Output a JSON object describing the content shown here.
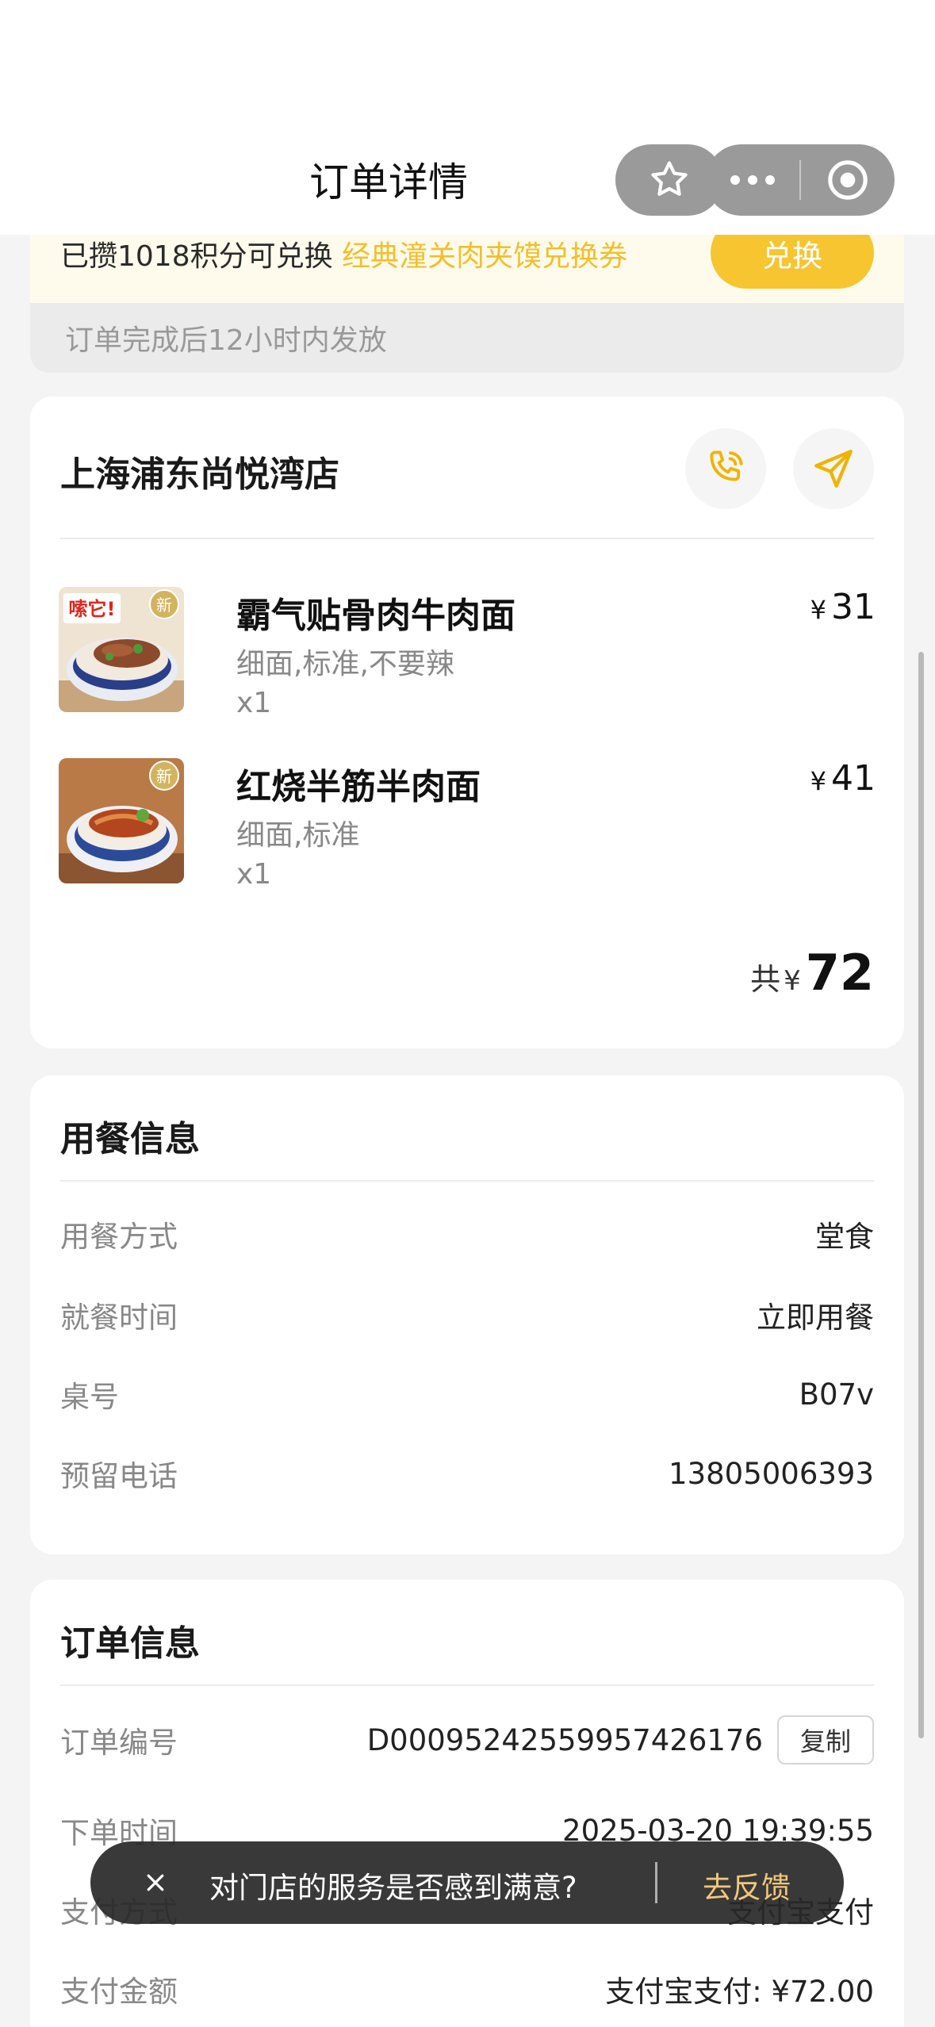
{
  "header": {
    "title": "订单详情"
  },
  "points_banner": {
    "text_prefix": "已攒1018积分可兑换",
    "highlight": "经典潼关肉夹馍兑换券",
    "exchange_label": "兑换",
    "note": "订单完成后12小时内发放"
  },
  "store": {
    "name": "上海浦东尚悦湾店",
    "items": [
      {
        "name": "霸气贴骨肉牛肉面",
        "spec": "细面,标准,不要辣",
        "qty": "x1",
        "currency": "¥",
        "price": "31",
        "badge_text": "嗦它!",
        "new_badge": "新"
      },
      {
        "name": "红烧半筋半肉面",
        "spec": "细面,标准",
        "qty": "x1",
        "currency": "¥",
        "price": "41",
        "new_badge": "新"
      }
    ],
    "total_label": "共",
    "total_currency": "¥",
    "total_amount": "72"
  },
  "dining": {
    "title": "用餐信息",
    "rows": [
      {
        "label": "用餐方式",
        "value": "堂食"
      },
      {
        "label": "就餐时间",
        "value": "立即用餐"
      },
      {
        "label": "桌号",
        "value": "B07v"
      },
      {
        "label": "预留电话",
        "value": "13805006393"
      }
    ]
  },
  "order": {
    "title": "订单信息",
    "copy_label": "复制",
    "rows": [
      {
        "label": "订单编号",
        "value": "D0009524255995742617​6"
      },
      {
        "label": "下单时间",
        "value": "2025-03-20 19:39:55"
      },
      {
        "label": "支付方式",
        "value": "支付宝支付"
      },
      {
        "label": "支付金额",
        "value": "支付宝支付: ¥72.00"
      }
    ]
  },
  "toast": {
    "text": "对门店的服务是否感到满意?",
    "action": "去反馈"
  },
  "colors": {
    "accent": "#f7c530",
    "highlight": "#f3bf2a",
    "toast_action": "#f1c77a"
  }
}
